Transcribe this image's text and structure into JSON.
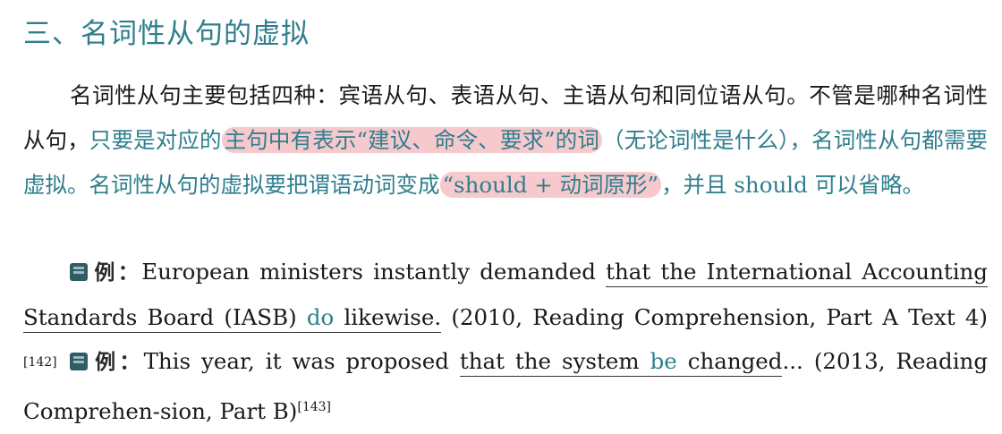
{
  "section": {
    "title": "三、名词性从句的虚拟"
  },
  "paragraph": {
    "text1": "名词性从句主要包括四种：宾语从句、表语从句、主语从句和同位语从句。不管是哪种名词性从句，",
    "teal1": "只要是对应的",
    "highlight1": "主句中有表示“建议、命令、要求”的词",
    "teal2": "（无论词性是什么），名词性从句都需要虚拟。名词性从句的虚拟要把谓语动词变成",
    "highlight2": "“should + 动词原形”",
    "teal3": "，并且 should 可以省略。"
  },
  "examples": [
    {
      "label": "例：",
      "pre": "European ministers instantly demanded ",
      "ul_a": "that the International Accounting Standards Board (IASB) ",
      "verb": "do",
      "ul_b": " likewise.",
      "post": " (2010, Reading Comprehension, Part A Text 4)",
      "ref": "[142]"
    },
    {
      "label": "例：",
      "pre": "This year, it was proposed ",
      "ul_a": "that the system ",
      "verb": "be",
      "ul_b": " changed",
      "post": "... (2013, Reading Comprehen-sion, Part B)",
      "ref": "[143]"
    }
  ],
  "colors": {
    "accent": "#2f7e8e",
    "highlight": "#f6c9cd"
  },
  "icons": {
    "example": "book-icon"
  }
}
